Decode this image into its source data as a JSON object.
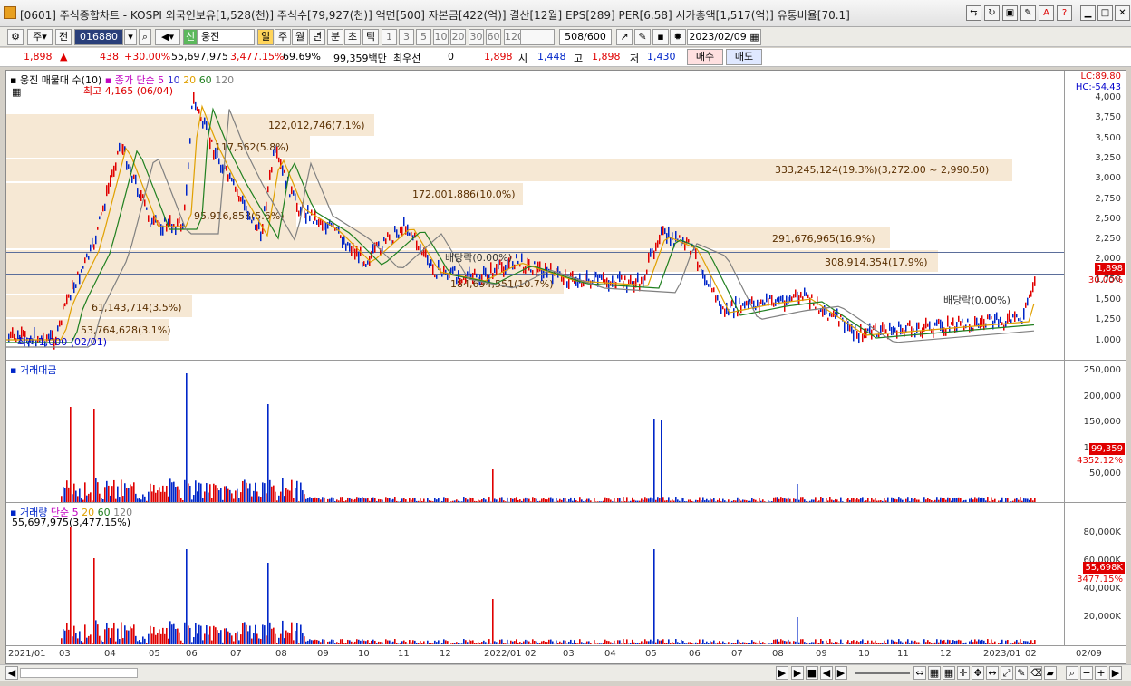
{
  "window": {
    "title": "[0601] 주식종합차트 - KOSPI 외국인보유[1,528(천)] 주식수[79,927(천)] 액면[500] 자본금[422(억)] 결산[12월] EPS[289] PER[6.58] 시가총액[1,517(억)] 유통비율[70.1]"
  },
  "toolbar": {
    "type_select": "주",
    "prev_label": "전",
    "code": "016880",
    "badge": "신",
    "stock_name": "웅진",
    "periods": [
      "일",
      "주",
      "월",
      "년",
      "분",
      "초",
      "틱"
    ],
    "active_period": "일",
    "minutes": [
      "1",
      "3",
      "5",
      "10",
      "20",
      "30",
      "60",
      "120"
    ],
    "count": "508",
    "count_total": "/600",
    "date": "2023/02/09"
  },
  "quote": {
    "price": "1,898",
    "change": "438",
    "change_pct": "+30.00%",
    "volume": "55,697,975",
    "volume_pct": "3,477.15%",
    "turnover_ratio": "69.69%",
    "amount": "99,359백만",
    "best_label": "최우선",
    "best_value": "0",
    "best_price": "1,898",
    "open_label": "시",
    "open": "1,448",
    "high_label": "고",
    "high": "1,898",
    "low_label": "저",
    "low": "1,430",
    "buy_label": "매수",
    "sell_label": "매도"
  },
  "price_panel": {
    "legend_name": "웅진 매물대 수(10)",
    "legend_ma": "종가 단순 5",
    "legend_ma_periods": [
      "10",
      "20",
      "60",
      "120"
    ],
    "lc": "LC:89.80",
    "hc": "HC:-54.43",
    "high_note": "최고 4,165 (06/04)",
    "low_note": "최저 1,000 (02/01)",
    "dividend_notes": [
      "배당락(0.00%)",
      "배당락(0.00%)"
    ],
    "yticks": [
      "4,000",
      "3,750",
      "3,500",
      "3,250",
      "3,000",
      "2,750",
      "2,500",
      "2,250",
      "2,000",
      "1,750",
      "1,500",
      "1,250",
      "1,000"
    ],
    "last_price_tag": "1,898",
    "last_pct_tag": "30.00%",
    "volume_profile": [
      "122,012,746(7.1%)",
      "117,562(5.8%)",
      "333,245,124(19.3%)(3,272.00 ~ 2,990.50)",
      "172,001,886(10.0%)",
      "95,916,858(5.6%)",
      "291,676,965(16.9%)",
      "308,914,354(17.9%)",
      "184,694,551(10.7%)",
      "61,143,714(3.5%)",
      "53,764,628(3.1%)"
    ]
  },
  "amount_panel": {
    "title": "거래대금",
    "yticks": [
      "250,000",
      "200,000",
      "150,000",
      "100,000",
      "50,000"
    ],
    "last_tag": "99,359",
    "last_pct": "4352.12%"
  },
  "volume_panel": {
    "title": "거래량",
    "legend_ma": "단순 5",
    "legend_ma_periods": [
      "20",
      "60",
      "120"
    ],
    "value_note": "55,697,975(3,477.15%)",
    "yticks": [
      "80,000K",
      "60,000K",
      "40,000K",
      "20,000K"
    ],
    "last_tag": "55,698K",
    "last_pct": "3477.15%"
  },
  "xaxis": {
    "ticks": [
      "2021/01",
      "03",
      "04",
      "05",
      "06",
      "07",
      "08",
      "09",
      "10",
      "11",
      "12",
      "2022/01",
      "02",
      "03",
      "04",
      "05",
      "06",
      "07",
      "08",
      "09",
      "10",
      "11",
      "12",
      "2023/01",
      "02"
    ],
    "end_label": "02/09"
  },
  "colors": {
    "up": "#e00000",
    "down": "#0026c9",
    "ma5": "#c000c0",
    "ma10": "#2b2bd0",
    "ma20": "#e0a000",
    "ma60": "#208020",
    "ma120": "#808080",
    "band": "#f4e4cc"
  }
}
